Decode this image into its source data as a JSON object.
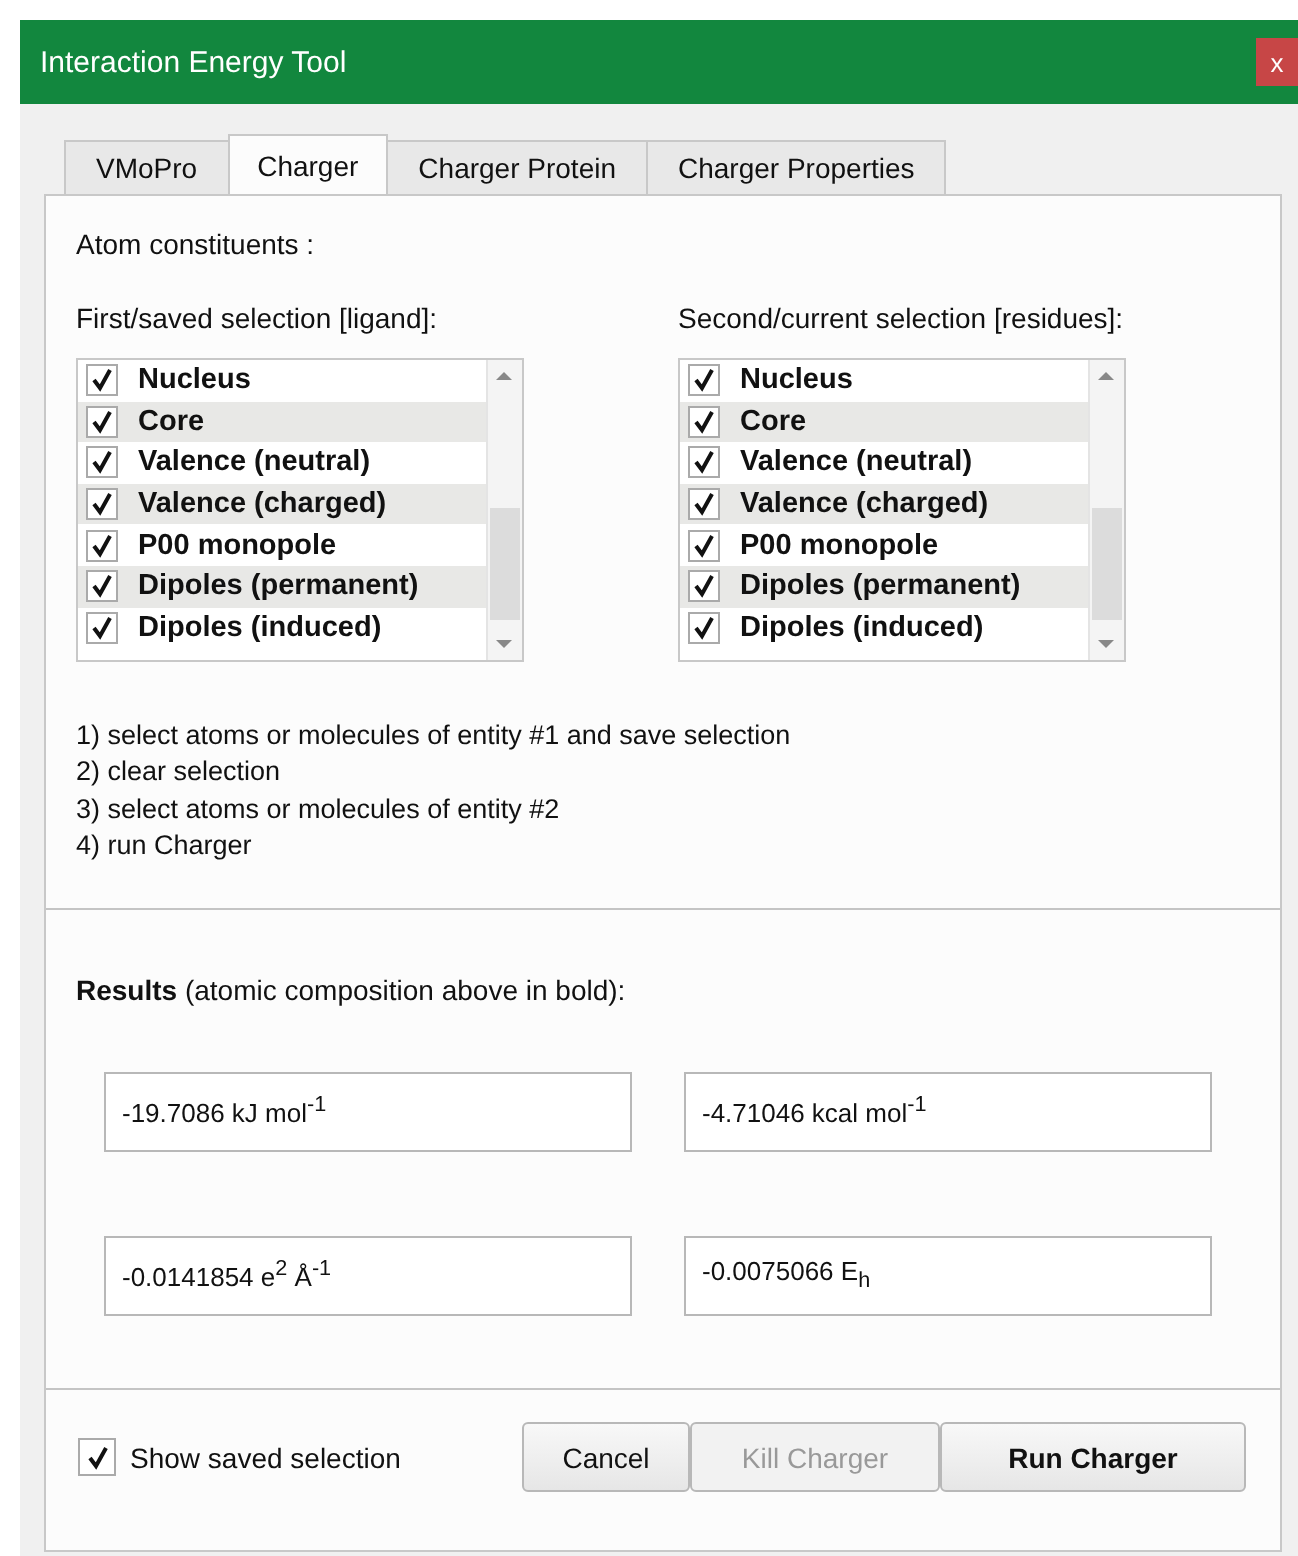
{
  "window": {
    "title": "Interaction Energy Tool",
    "close": "x"
  },
  "tabs": [
    {
      "label": "VMoPro",
      "selected": false
    },
    {
      "label": "Charger",
      "selected": true
    },
    {
      "label": "Charger Protein",
      "selected": false
    },
    {
      "label": "Charger Properties",
      "selected": false
    }
  ],
  "atom_heading": "Atom constituents :",
  "lists": [
    {
      "label": "First/saved selection [ligand]:",
      "items": [
        {
          "label": "Nucleus",
          "checked": true
        },
        {
          "label": "Core",
          "checked": true
        },
        {
          "label": "Valence (neutral)",
          "checked": true
        },
        {
          "label": "Valence (charged)",
          "checked": true
        },
        {
          "label": "P00 monopole",
          "checked": true
        },
        {
          "label": "Dipoles (permanent)",
          "checked": true
        },
        {
          "label": "Dipoles (induced)",
          "checked": true
        }
      ]
    },
    {
      "label": "Second/current selection [residues]:",
      "items": [
        {
          "label": "Nucleus",
          "checked": true
        },
        {
          "label": "Core",
          "checked": true
        },
        {
          "label": "Valence (neutral)",
          "checked": true
        },
        {
          "label": "Valence (charged)",
          "checked": true
        },
        {
          "label": "P00 monopole",
          "checked": true
        },
        {
          "label": "Dipoles (permanent)",
          "checked": true
        },
        {
          "label": "Dipoles (induced)",
          "checked": true
        }
      ]
    }
  ],
  "instructions": [
    "1) select atoms or molecules of entity #1 and save selection",
    "2) clear selection",
    "3) select atoms or molecules of entity #2",
    "4) run Charger"
  ],
  "results_heading": "**Results** (atomic composition above in bold):",
  "results": [
    "-19.7086 kJ mol$^{-1}$",
    "-4.71046 kcal mol$^{-1}$",
    "-0.0141854 e$^{2}$ Å$^{-1}$",
    "-0.0075066 E$_{h}$"
  ],
  "show_saved": {
    "label": "Show saved selection",
    "checked": true
  },
  "buttons": [
    {
      "label": "Cancel",
      "disabled": false,
      "default": false
    },
    {
      "label": "Kill Charger",
      "disabled": true,
      "default": false
    },
    {
      "label": "Run Charger",
      "disabled": false,
      "default": true
    }
  ]
}
